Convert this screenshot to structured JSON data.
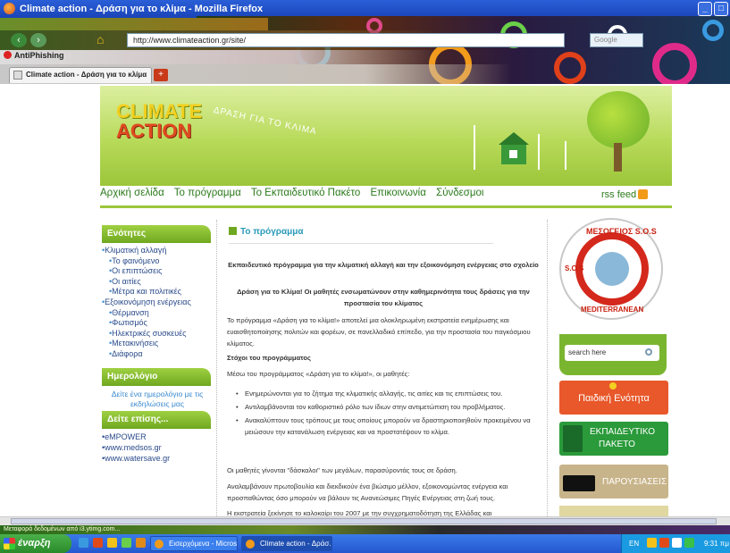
{
  "window": {
    "title": "Climate action - Δράση για το κλίμα - Mozilla Firefox",
    "min": "_",
    "max": "□"
  },
  "browser": {
    "url": "http://www.climateaction.gr/site/",
    "search_placeholder": "Google",
    "antiphishing_label": "AntiPhishing",
    "tab_label": "Climate action - Δράση για το κλίμα",
    "new_tab": "+",
    "back_icon": "‹",
    "forward_icon": "›",
    "home_icon": "⌂"
  },
  "site": {
    "logo_line1": "CLIMATE",
    "logo_line2": "ACTION",
    "tagline": "ΔΡΑΣΗ ΓΙΑ ΤΟ ΚΛΙΜΑ",
    "nav": [
      "Αρχική σελίδα",
      "Το πρόγραμμα",
      "Το Εκπαιδευτικό Πακέτο",
      "Επικοινωνία",
      "Σύνδεσμοι"
    ],
    "rss": "rss feed"
  },
  "sidebar": {
    "sections_title": "Ενότητες",
    "items": [
      {
        "label": "Κλιματική αλλαγή",
        "level": 0
      },
      {
        "label": "Το φαινόμενο",
        "level": 1
      },
      {
        "label": "Οι επιπτώσεις",
        "level": 1
      },
      {
        "label": "Οι αιτίες",
        "level": 1
      },
      {
        "label": "Μέτρα και πολιτικές",
        "level": 1
      },
      {
        "label": "Εξοικονόμηση ενέργειας",
        "level": 0
      },
      {
        "label": "Θέρμανση",
        "level": 1
      },
      {
        "label": "Φωτισμός",
        "level": 1
      },
      {
        "label": "Ηλεκτρικές συσκευές",
        "level": 1
      },
      {
        "label": "Μετακινήσεις",
        "level": 1
      },
      {
        "label": "Διάφορα",
        "level": 1
      }
    ],
    "calendar_title": "Ημερολόγιο",
    "calendar_link_1": "Δείτε ένα ημερολόγιο με τις",
    "calendar_link_2": "εκδηλώσεις μας",
    "see_also_title": "Δείτε επίσης...",
    "see_also": [
      "eMPOWER",
      "www.medsos.gr",
      "www.watersave.gr"
    ]
  },
  "content": {
    "title": "Το πρόγραμμα",
    "lead1": "Εκπαιδευτικό πρόγραμμα για την κλιματική αλλαγή και την εξοικονόμηση ενέργειας στο σχολείο",
    "lead2": "Δράση για το Κλίμα! Οι μαθητές ενσωματώνουν στην καθημερινότητα τους δράσεις για την προστασία του κλίματος",
    "p1": "Το πρόγραμμα «Δράση για το κλίμα!» αποτελεί μια ολοκληρωμένη εκστρατεία ενημέρωσης και ευαισθητοποίησης πολιτών και φορέων, σε πανελλαδικό επίπεδο, για την προστασία του παγκόσμιου κλίματος.",
    "goals_title": "Στόχοι του προγράμματος",
    "p2": "Μέσω του προγράμματος «Δράση για το κλίμα!», οι μαθητές:",
    "bullets": [
      "Ενημερώνονται για το ζήτημα της κλιματικής αλλαγής, τις αιτίες και τις επιπτώσεις του.",
      "Αντιλαμβάνονται τον καθοριστικό ρόλο των ίδιων στην αντιμετώπιση του προβλήματος.",
      "Ανακαλύπτουν τους τρόπους με τους οποίους μπορούν να δραστηριοποιηθούν προκειμένου να μειώσουν την κατανάλωση ενέργειας και να προστατέψουν το κλίμα."
    ],
    "p3": "Οι μαθητές γίνονται \"δάσκαλοι\" των μεγάλων, παρασύροντάς τους σε δράση.",
    "p4": "Αναλαμβάνουν πρωτοβουλία και διεκδικούν ένα βιώσιμο μέλλον, εξοικονομώντας ενέργεια και προσπαθώντας όσο μπορούν να βάλουν τις Ανανεώσιμες Πηγές Ενέργειας στη ζωή τους.",
    "p5": "Η εκστρατεία ξεκίνησε το καλοκαίρι του 2007 με την συγχρηματοδότηση της Ελλάδας και"
  },
  "right": {
    "medsos_top": "ΜΕΣΟΓΕΙΟΣ S.O.S",
    "medsos_left": "S.O.S",
    "medsos_bottom": "ΜΕDITERRANEAN",
    "search_placeholder": "search here",
    "btn_kids": "Παιδική Ενότητα",
    "btn_edu_1": "ΕΚΠΑΙΔΕΥΤΙΚΟ",
    "btn_edu_2": "ΠΑΚΕΤΟ",
    "btn_presentations": "ΠΑΡΟΥΣΙΑΣΕΙΣ"
  },
  "status": {
    "text": "Μεταφορά δεδομένων από i3.ytimg.com..."
  },
  "taskbar": {
    "start": "έναρξη",
    "tasks": [
      "Εισερχόμενα - Micros...",
      "Climate action - Δράσ..."
    ],
    "lang": "EN",
    "clock": "9:31 πμ"
  },
  "colors": {
    "brand_green": "#7ab530",
    "link_green": "#2a7a1a",
    "heading_teal": "#2a9ab8",
    "kids_orange": "#e8582a",
    "edu_green": "#2a9a3a",
    "present_tan": "#c8b48a"
  }
}
